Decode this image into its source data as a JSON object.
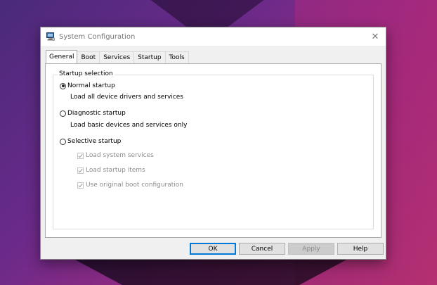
{
  "window": {
    "title": "System Configuration",
    "close_glyph": "✕",
    "icon": "system-configuration-icon"
  },
  "tabs": [
    {
      "label": "General",
      "active": true
    },
    {
      "label": "Boot",
      "active": false
    },
    {
      "label": "Services",
      "active": false
    },
    {
      "label": "Startup",
      "active": false
    },
    {
      "label": "Tools",
      "active": false
    }
  ],
  "general": {
    "group_label": "Startup selection",
    "options": [
      {
        "label": "Normal startup",
        "description": "Load all device drivers and services",
        "selected": true
      },
      {
        "label": "Diagnostic startup",
        "description": "Load basic devices and services only",
        "selected": false
      },
      {
        "label": "Selective startup",
        "selected": false
      }
    ],
    "selective_items": [
      {
        "label": "Load system services",
        "checked": true,
        "enabled": false
      },
      {
        "label": "Load startup items",
        "checked": true,
        "enabled": false
      },
      {
        "label": "Use original boot configuration",
        "checked": true,
        "enabled": false
      }
    ]
  },
  "buttons": {
    "ok": "OK",
    "cancel": "Cancel",
    "apply": "Apply",
    "help": "Help"
  },
  "colors": {
    "accent": "#0078d7",
    "window_bg": "#f0f0f0",
    "disabled_text": "#8c8c8c"
  }
}
